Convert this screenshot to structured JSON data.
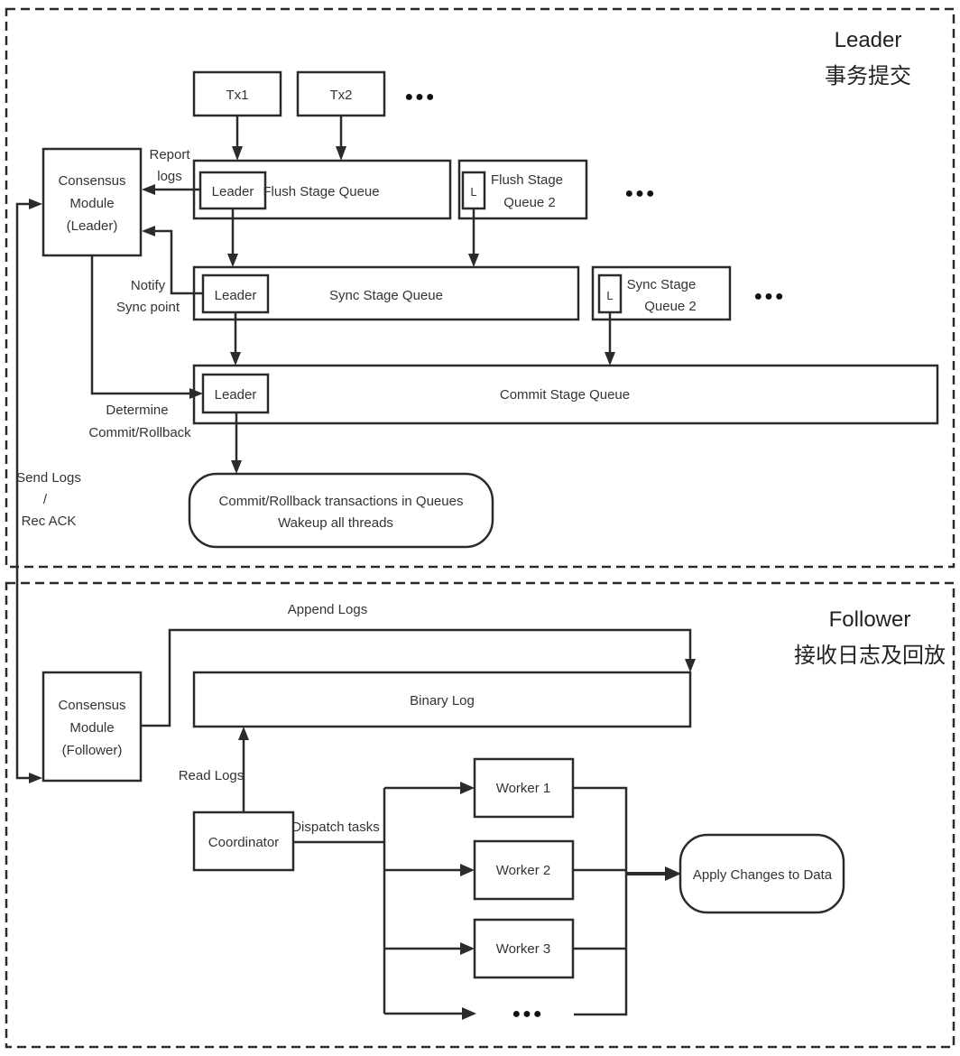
{
  "regions": {
    "leader": {
      "title": "Leader",
      "subtitle": "事务提交"
    },
    "follower": {
      "title": "Follower",
      "subtitle": "接收日志及回放"
    }
  },
  "leader_side": {
    "transactions": [
      "Tx1",
      "Tx2"
    ],
    "consensus_module": [
      "Consensus",
      "Module",
      "(Leader)"
    ],
    "flush_queue": {
      "leader": "Leader",
      "label": "Flush Stage Queue"
    },
    "flush_queue_2": {
      "leader": "L",
      "label_line1": "Flush Stage",
      "label_line2": "Queue 2"
    },
    "sync_queue": {
      "leader": "Leader",
      "label": "Sync Stage Queue"
    },
    "sync_queue_2": {
      "leader": "L",
      "label_line1": "Sync Stage",
      "label_line2": "Queue 2"
    },
    "commit_queue": {
      "leader": "Leader",
      "label": "Commit Stage Queue"
    },
    "result": {
      "line1": "Commit/Rollback transactions in Queues",
      "line2": "Wakeup all threads"
    },
    "edge_labels": {
      "report_logs": [
        "Report",
        "logs"
      ],
      "notify_sync": [
        "Notify",
        "Sync point"
      ],
      "determine": [
        "Determine",
        "Commit/Rollback"
      ],
      "send_logs": [
        "Send Logs",
        "/",
        "Rec ACK"
      ]
    },
    "ellipsis": "●●●"
  },
  "follower_side": {
    "consensus_module": [
      "Consensus",
      "Module",
      "(Follower)"
    ],
    "binary_log": "Binary Log",
    "coordinator": "Coordinator",
    "workers": [
      "Worker  1",
      "Worker 2",
      "Worker 3"
    ],
    "apply": "Apply Changes to Data",
    "edge_labels": {
      "append_logs": "Append Logs",
      "read_logs": "Read Logs",
      "dispatch": "Dispatch tasks"
    },
    "ellipsis": "●●●"
  }
}
